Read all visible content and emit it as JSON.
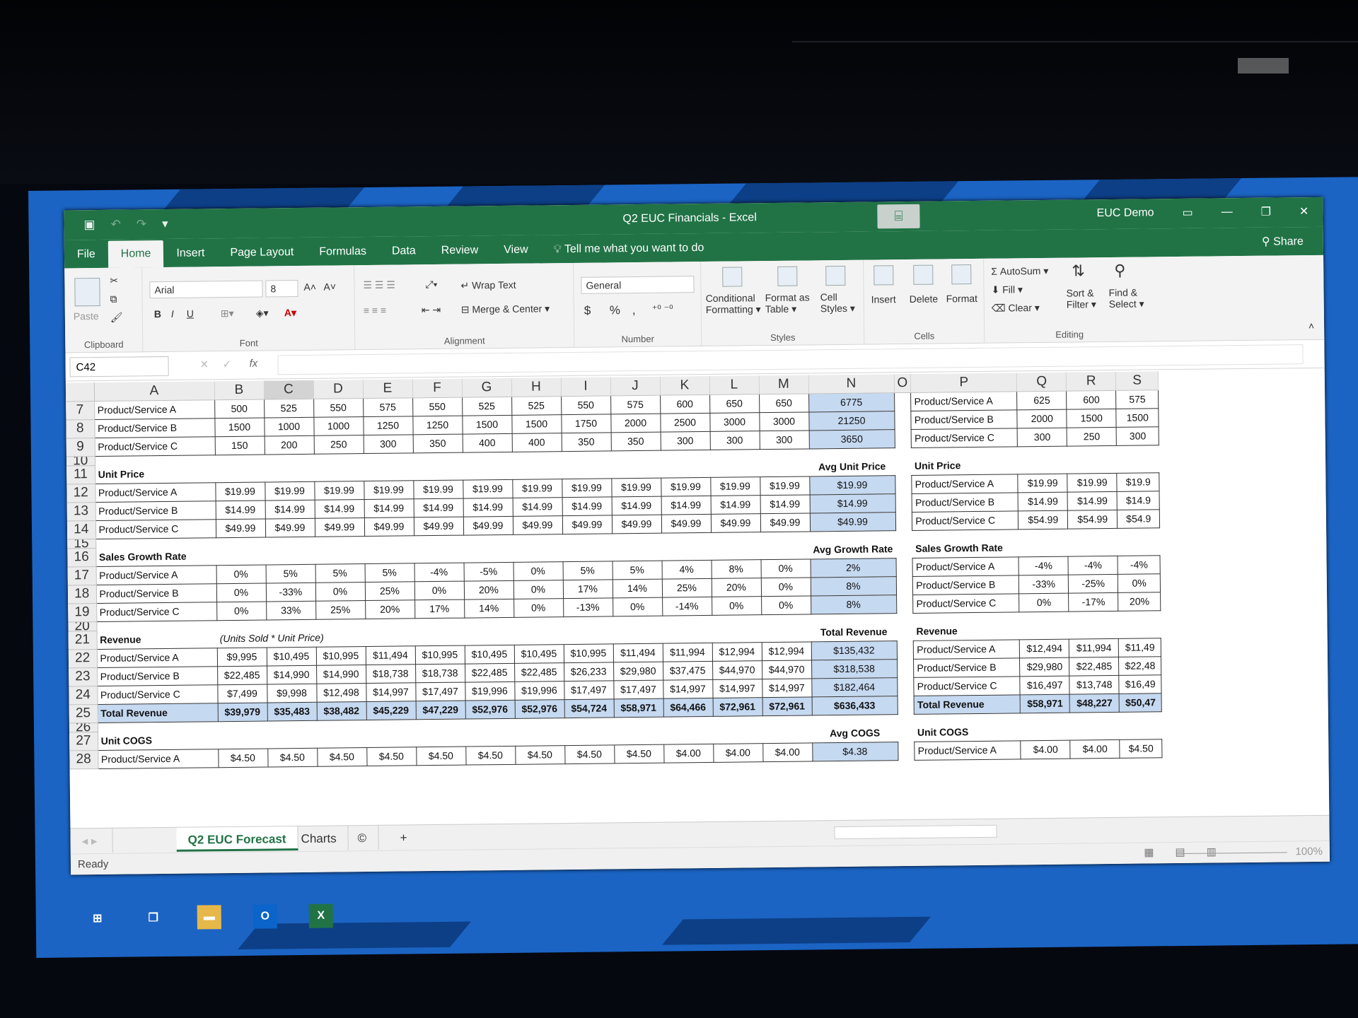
{
  "window": {
    "title": "Q2 EUC Financials - Excel",
    "account": "EUC Demo"
  },
  "menu": {
    "tabs": [
      "File",
      "Home",
      "Insert",
      "Page Layout",
      "Formulas",
      "Data",
      "Review",
      "View"
    ],
    "active": "Home",
    "tell_me": "Tell me what you want to do",
    "share": "Share"
  },
  "ribbon": {
    "clipboard": {
      "paste": "Paste",
      "label": "Clipboard"
    },
    "font": {
      "name": "Arial",
      "size": "8",
      "bold": "B",
      "italic": "I",
      "underline": "U",
      "label": "Font"
    },
    "alignment": {
      "wrap": "Wrap Text",
      "merge": "Merge & Center",
      "label": "Alignment"
    },
    "number": {
      "format": "General",
      "currency": "$",
      "percent": "%",
      "comma": ",",
      "label": "Number"
    },
    "styles": {
      "conditional_1": "Conditional",
      "conditional_2": "Formatting",
      "format_table_1": "Format as",
      "format_table_2": "Table",
      "cell_styles_1": "Cell",
      "cell_styles_2": "Styles",
      "label": "Styles"
    },
    "cells": {
      "insert": "Insert",
      "delete": "Delete",
      "format": "Format",
      "label": "Cells"
    },
    "editing": {
      "autosum": "AutoSum",
      "fill": "Fill",
      "clear": "Clear",
      "sort_1": "Sort &",
      "sort_2": "Filter",
      "find_1": "Find &",
      "find_2": "Select",
      "label": "Editing"
    }
  },
  "formula_bar": {
    "name_box": "C42",
    "fx": "fx",
    "value": ""
  },
  "columns": [
    "A",
    "B",
    "C",
    "D",
    "E",
    "F",
    "G",
    "H",
    "I",
    "J",
    "K",
    "L",
    "M",
    "N",
    "O",
    "P",
    "Q",
    "R",
    "S"
  ],
  "rows": [
    {
      "n": "7",
      "type": "data",
      "cells": [
        "Product/Service A",
        "500",
        "525",
        "550",
        "575",
        "550",
        "525",
        "525",
        "550",
        "575",
        "600",
        "650",
        "650"
      ],
      "n_col": "6775",
      "p": "Product/Service A",
      "q": "625",
      "r": "600",
      "s": "575"
    },
    {
      "n": "8",
      "type": "data",
      "cells": [
        "Product/Service B",
        "1500",
        "1000",
        "1000",
        "1250",
        "1250",
        "1500",
        "1500",
        "1750",
        "2000",
        "2500",
        "3000",
        "3000"
      ],
      "n_col": "21250",
      "p": "Product/Service B",
      "q": "2000",
      "r": "1500",
      "s": "1500"
    },
    {
      "n": "9",
      "type": "data",
      "cells": [
        "Product/Service C",
        "150",
        "200",
        "250",
        "300",
        "350",
        "400",
        "400",
        "350",
        "350",
        "300",
        "300",
        "300"
      ],
      "n_col": "3650",
      "p": "Product/Service C",
      "q": "300",
      "r": "250",
      "s": "300"
    },
    {
      "n": "10",
      "type": "thin"
    },
    {
      "n": "11",
      "type": "header",
      "a": "Unit Price",
      "n_col": "Avg Unit Price",
      "p": "Unit Price"
    },
    {
      "n": "12",
      "type": "data",
      "cells": [
        "Product/Service A",
        "$19.99",
        "$19.99",
        "$19.99",
        "$19.99",
        "$19.99",
        "$19.99",
        "$19.99",
        "$19.99",
        "$19.99",
        "$19.99",
        "$19.99",
        "$19.99"
      ],
      "n_col": "$19.99",
      "p": "Product/Service A",
      "q": "$19.99",
      "r": "$19.99",
      "s": "$19.9"
    },
    {
      "n": "13",
      "type": "data",
      "cells": [
        "Product/Service B",
        "$14.99",
        "$14.99",
        "$14.99",
        "$14.99",
        "$14.99",
        "$14.99",
        "$14.99",
        "$14.99",
        "$14.99",
        "$14.99",
        "$14.99",
        "$14.99"
      ],
      "n_col": "$14.99",
      "p": "Product/Service B",
      "q": "$14.99",
      "r": "$14.99",
      "s": "$14.9"
    },
    {
      "n": "14",
      "type": "data",
      "cells": [
        "Product/Service C",
        "$49.99",
        "$49.99",
        "$49.99",
        "$49.99",
        "$49.99",
        "$49.99",
        "$49.99",
        "$49.99",
        "$49.99",
        "$49.99",
        "$49.99",
        "$49.99"
      ],
      "n_col": "$49.99",
      "p": "Product/Service C",
      "q": "$54.99",
      "r": "$54.99",
      "s": "$54.9"
    },
    {
      "n": "15",
      "type": "thin"
    },
    {
      "n": "16",
      "type": "header",
      "a": "Sales Growth Rate",
      "n_col": "Avg Growth Rate",
      "p": "Sales Growth Rate"
    },
    {
      "n": "17",
      "type": "data",
      "cells": [
        "Product/Service A",
        "0%",
        "5%",
        "5%",
        "5%",
        "-4%",
        "-5%",
        "0%",
        "5%",
        "5%",
        "4%",
        "8%",
        "0%"
      ],
      "n_col": "2%",
      "p": "Product/Service A",
      "q": "-4%",
      "r": "-4%",
      "s": "-4%"
    },
    {
      "n": "18",
      "type": "data",
      "cells": [
        "Product/Service B",
        "0%",
        "-33%",
        "0%",
        "25%",
        "0%",
        "20%",
        "0%",
        "17%",
        "14%",
        "25%",
        "20%",
        "0%"
      ],
      "n_col": "8%",
      "p": "Product/Service B",
      "q": "-33%",
      "r": "-25%",
      "s": "0%"
    },
    {
      "n": "19",
      "type": "data",
      "cells": [
        "Product/Service C",
        "0%",
        "33%",
        "25%",
        "20%",
        "17%",
        "14%",
        "0%",
        "-13%",
        "0%",
        "-14%",
        "0%",
        "0%"
      ],
      "n_col": "8%",
      "p": "Product/Service C",
      "q": "0%",
      "r": "-17%",
      "s": "20%"
    },
    {
      "n": "20",
      "type": "thin"
    },
    {
      "n": "21",
      "type": "header",
      "a": "Revenue",
      "note": "(Units Sold * Unit Price)",
      "n_col": "Total Revenue",
      "p": "Revenue"
    },
    {
      "n": "22",
      "type": "data",
      "cells": [
        "Product/Service A",
        "$9,995",
        "$10,495",
        "$10,995",
        "$11,494",
        "$10,995",
        "$10,495",
        "$10,495",
        "$10,995",
        "$11,494",
        "$11,994",
        "$12,994",
        "$12,994"
      ],
      "n_col": "$135,432",
      "p": "Product/Service A",
      "q": "$12,494",
      "r": "$11,994",
      "s": "$11,49"
    },
    {
      "n": "23",
      "type": "data",
      "cells": [
        "Product/Service B",
        "$22,485",
        "$14,990",
        "$14,990",
        "$18,738",
        "$18,738",
        "$22,485",
        "$22,485",
        "$26,233",
        "$29,980",
        "$37,475",
        "$44,970",
        "$44,970"
      ],
      "n_col": "$318,538",
      "p": "Product/Service B",
      "q": "$29,980",
      "r": "$22,485",
      "s": "$22,48"
    },
    {
      "n": "24",
      "type": "data",
      "cells": [
        "Product/Service C",
        "$7,499",
        "$9,998",
        "$12,498",
        "$14,997",
        "$17,497",
        "$19,996",
        "$19,996",
        "$17,497",
        "$17,497",
        "$14,997",
        "$14,997",
        "$14,997"
      ],
      "n_col": "$182,464",
      "p": "Product/Service C",
      "q": "$16,497",
      "r": "$13,748",
      "s": "$16,49"
    },
    {
      "n": "25",
      "type": "total",
      "cells": [
        "Total Revenue",
        "$39,979",
        "$35,483",
        "$38,482",
        "$45,229",
        "$47,229",
        "$52,976",
        "$52,976",
        "$54,724",
        "$58,971",
        "$64,466",
        "$72,961",
        "$72,961"
      ],
      "n_col": "$636,433",
      "p": "Total Revenue",
      "q": "$58,971",
      "r": "$48,227",
      "s": "$50,47"
    },
    {
      "n": "26",
      "type": "thin"
    },
    {
      "n": "27",
      "type": "header",
      "a": "Unit COGS",
      "n_col": "Avg COGS",
      "p": "Unit COGS"
    },
    {
      "n": "28",
      "type": "data",
      "cells": [
        "Product/Service A",
        "$4.50",
        "$4.50",
        "$4.50",
        "$4.50",
        "$4.50",
        "$4.50",
        "$4.50",
        "$4.50",
        "$4.50",
        "$4.00",
        "$4.00",
        "$4.00"
      ],
      "n_col": "$4.38",
      "p": "Product/Service A",
      "q": "$4.00",
      "r": "$4.00",
      "s": "$4.50"
    }
  ],
  "sheets": {
    "active": "Q2 EUC Forecast",
    "others": [
      "Charts"
    ],
    "more": "©",
    "add": "+"
  },
  "status": {
    "ready": "Ready",
    "zoom": "100%"
  },
  "colors": {
    "excel_green": "#217346",
    "highlight_blue": "#c5d9f1"
  }
}
